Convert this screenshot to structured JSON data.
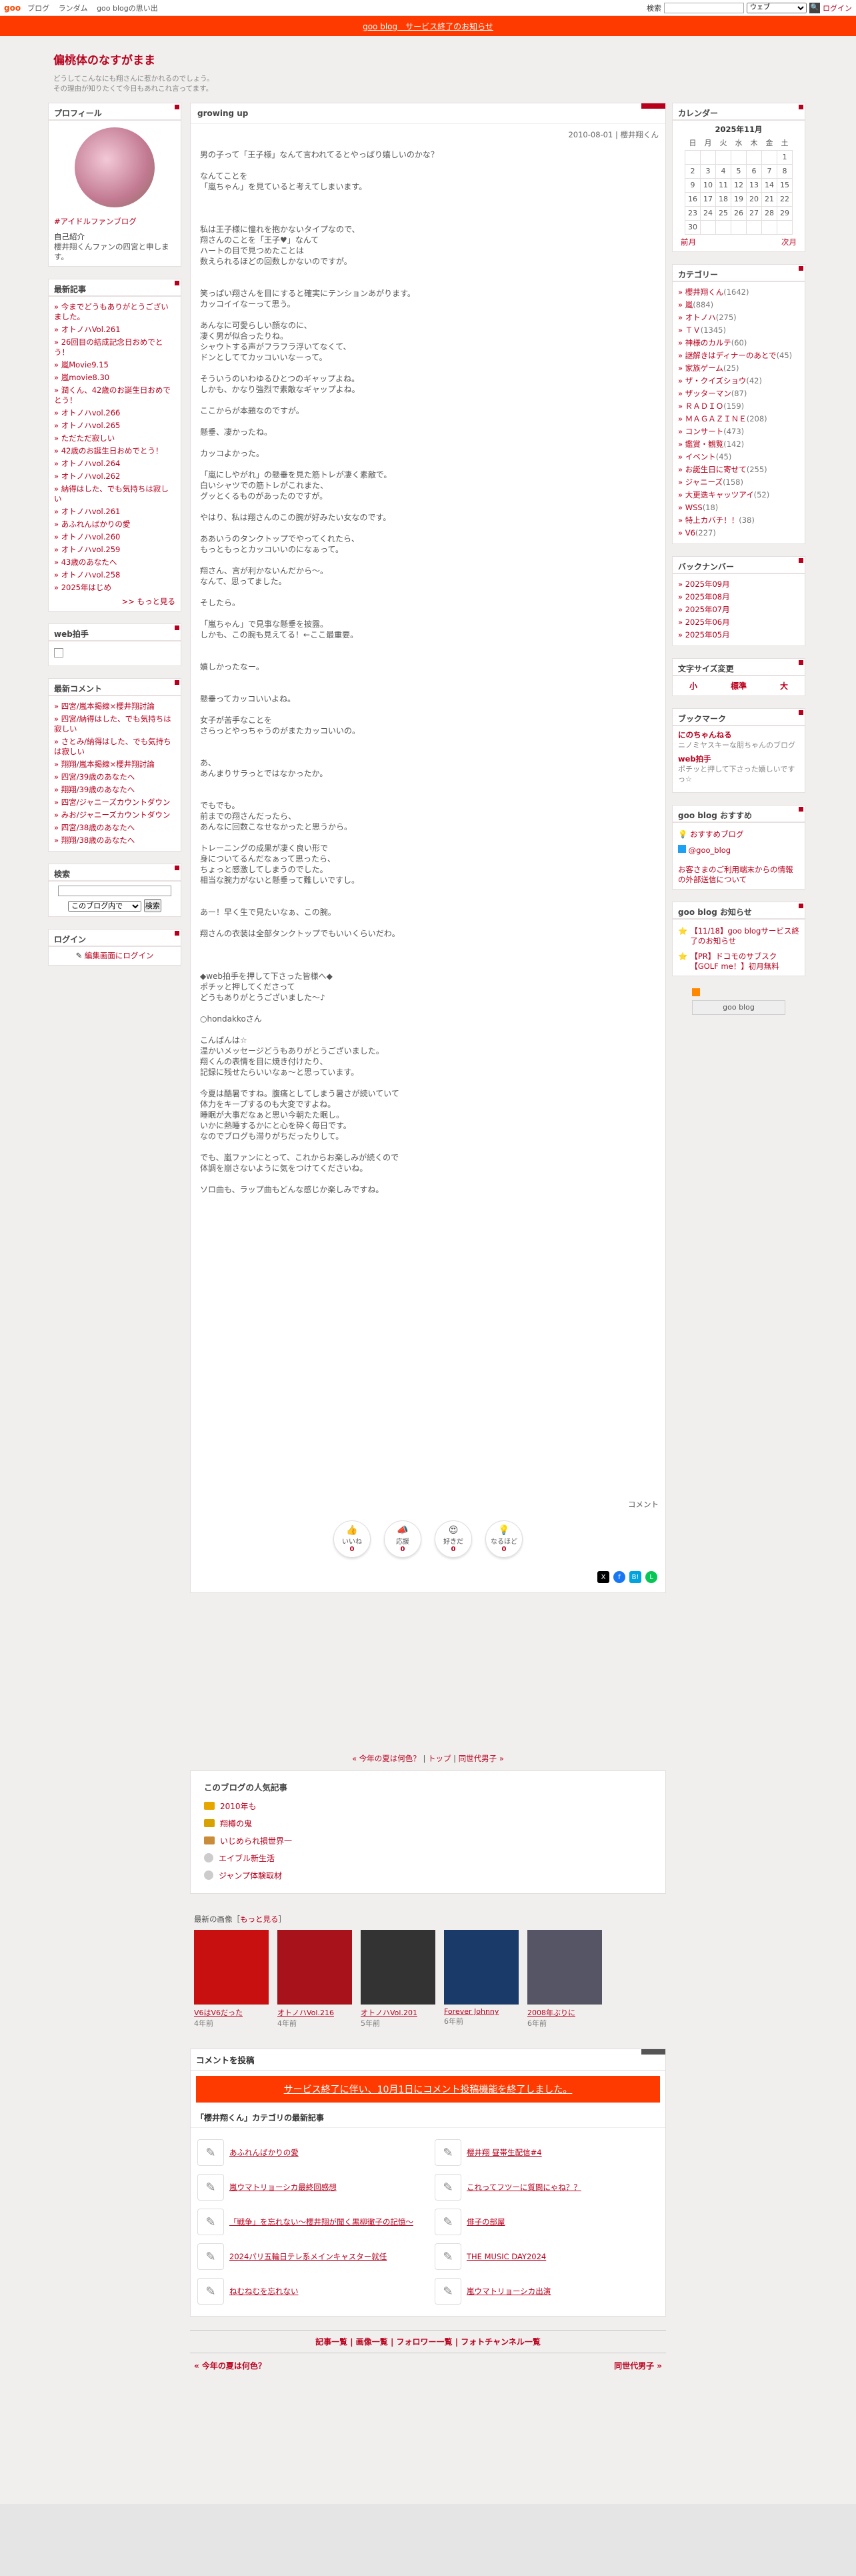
{
  "topbar": {
    "logo": "goo",
    "nav": [
      "ブログ",
      "ランダム",
      "goo blogの思い出"
    ],
    "search_label": "検索",
    "select": "ウェブ",
    "search_btn": "🔍",
    "login": "ログイン"
  },
  "notice": "goo blog　サービス終了のお知らせ",
  "header": {
    "title": "偏桃体のなすがまま",
    "desc1": "どうしてこんなにも翔さんに惹かれるのでしょう。",
    "desc2": "その理由が知りたくて今日もあれこれ言ってます。"
  },
  "profile": {
    "title": "プロフィール",
    "link": "#アイドルファンブログ",
    "intro_head": "自己紹介",
    "intro": "櫻井翔くんファンの四宮と申します。"
  },
  "recent": {
    "title": "最新記事",
    "items": [
      "今までどうもありがとうございました。",
      "オトノハVol.261",
      "26回目の結成記念日おめでとう！",
      "嵐Movie9.15",
      "嵐movie8.30",
      "潤くん、42歳のお誕生日おめでとう！",
      "オトノハvol.266",
      "オトノハvol.265",
      "ただただ寂しい",
      "42歳のお誕生日おめでとう！",
      "オトノハvol.264",
      "オトノハvol.262",
      "納得はした、でも気持ちは寂しい",
      "オトノハvol.261",
      "あふれんばかりの愛",
      "オトノハvol.260",
      "オトノハvol.259",
      "43歳のあなたへ",
      "オトノハvol.258",
      "2025年はじめ"
    ],
    "more": ">> もっと見る"
  },
  "webhand": {
    "title": "web拍手"
  },
  "comments": {
    "title": "最新コメント",
    "items": [
      "四宮/嵐本掲線×櫻井翔討論",
      "四宮/納得はした、でも気持ちは寂しい",
      "さとみ/納得はした、でも気持ちは寂しい",
      "翔翔/嵐本掲線×櫻井翔討論",
      "四宮/39歳のあなたへ",
      "翔翔/39歳のあなたへ",
      "四宮/ジャニーズカウントダウン",
      "みお/ジャニーズカウントダウン",
      "四宮/38歳のあなたへ",
      "翔翔/38歳のあなたへ"
    ]
  },
  "search": {
    "title": "検索",
    "select": "このブログ内で",
    "btn": "検索"
  },
  "login": {
    "title": "ログイン",
    "link": "編集画面にログイン"
  },
  "article": {
    "title": "growing up",
    "meta": "2010-08-01 | 櫻井翔くん",
    "body": "男の子って「王子様」なんて言われてるとやっぱり嬉しいのかな？\n\nなんてことを\n「嵐ちゃん」を見ていると考えてしまいます。\n\n\n\n私は王子様に憧れを抱かないタイプなので、\n翔さんのことを「王子♥」なんて\nハートの目で見つめたことは\n数えられるほどの回数しかないのですが。\n\n\n笑っぱい翔さんを目にすると確実にテンションあがります。\nカッコイイなーって思う。\n\nあんなに可愛らしい顔なのに、\n凄く男が似合ったりね。\nシャウトする声がフラフラ浮いてなくて、\nドンとしててカッコいいなーって。\n\nそういうのいわゆるひとつのギャップよね。\nしかも、かなり強烈で素敵なギャップよね。\n\nここからが本題なのですが。\n\n懸垂、凄かったね。\n\nカッコよかった。\n\n「嵐にしやがれ」の懸垂を見た筋トレが凄く素敵で。\n白いシャツでの筋トレがこれまた、\nグッとくるものがあったのですが。\n\nやはり、私は翔さんのこの腕が好みたい女なのです。\n\nああいうのタンクトップでやってくれたら、\nもっともっとカッコいいのになぁって。\n\n翔さん、言が利かないんだから～。\nなんて、思ってました。\n\nそしたら。\n\n「嵐ちゃん」で見事な懸垂を披露。\nしかも、この腕も見えてる！←ここ最重要。\n\n\n嬉しかったなー。\n\n\n懸垂ってカッコいいよね。\n\n女子が苦手なことを\nさらっとやっちゃうのがまたカッコいいの。\n\n\nあ、\nあんまりサラっとではなかったか。\n\n\nでもでも。\n前までの翔さんだったら、\nあんなに回数こなせなかったと思うから。\n\nトレーニングの成果が凄く良い形で\n身についてるんだなぁって思ったら、\nちょっと感激してしまうのでした。\n相当な腕力がないと懸垂って難しいですし。\n\n\nあー！早く生で見たいなぁ、この腕。\n\n翔さんの衣装は全部タンクトップでもいいくらいだわ。\n\n\n\n◆web拍手を押して下さった皆様へ◆\nポチッと押してくださって\nどうもありがとうございました～♪\n\n○hondakkoさん\n\nこんばんは☆\n温かいメッセージどうもありがとうございました。\n翔くんの表情を目に焼き付けたり、\n記録に残せたらいいなぁ～と思っています。\n\n今夏は酷暑ですね。腹痛としてしまう暑さが続いていて\n体力をキープするのも大変ですよね。\n睡眠が大事だなぁと思い今朝たた眠し。\nいかに熱睡するかにと心を砕く毎日です。\nなのでブログも滞りがちだったりして。\n\nでも、嵐ファンにとって、これからお楽しみが続くので\n体調を崩さないように気をつけてくださいね。\n\nソロ曲も、ラップ曲もどんな感じか楽しみですね。",
    "comment": "コメント",
    "reactions": [
      {
        "t": "いいね",
        "n": "0"
      },
      {
        "t": "応援",
        "n": "0"
      },
      {
        "t": "好きだ",
        "n": "0"
      },
      {
        "t": "なるほど",
        "n": "0"
      }
    ],
    "react_labels": [
      "いいね",
      "応援",
      "好きだ",
      "なるほど"
    ]
  },
  "pager": {
    "prev": "« 今年の夏は何色？",
    "top": "トップ",
    "next": "同世代男子 »"
  },
  "popular": {
    "title": "このブログの人気記事",
    "items": [
      "2010年も",
      "翔樽の鬼",
      "いじめられ損世界一",
      "エイブル新生活",
      "ジャンプ体験取材"
    ]
  },
  "images": {
    "head": "最新の画像",
    "more": "もっと見る",
    "items": [
      {
        "c": "V6はV6だった",
        "y": "4年前"
      },
      {
        "c": "オトノハVol.216",
        "y": "4年前"
      },
      {
        "c": "オトノハVol.201",
        "y": "5年前"
      },
      {
        "c": "Forever Johnny",
        "y": "6年前"
      },
      {
        "c": "2008年ぶりに",
        "y": "6年前"
      }
    ]
  },
  "post": {
    "head": "コメントを投稿",
    "end": "サービス終了に伴い、10月1日にコメント投稿機能を終了しました。",
    "cat_head": "「櫻井翔くん」カテゴリの最新記事",
    "items": [
      "あふれんばかりの愛",
      "櫻井翔 昼帯生配信#4",
      "嵐ウマトリョーシカ最終回感想",
      "これってフツーに質問にゃね？？",
      "「戦争」を忘れない～櫻井翔が聞く黒柳徹子の記憶～",
      "俳子の部屋",
      "2024パリ五輪日テレ系メインキャスター就任",
      "THE MUSIC DAY2024",
      "ねむねむを忘れない",
      "嵐ウマトリョーシカ出演"
    ]
  },
  "foot": {
    "links": "記事一覧 | 画像一覧 | フォロワー一覧 | フォトチャンネル一覧",
    "prev": "« 今年の夏は何色？",
    "next": "同世代男子 »"
  },
  "calendar": {
    "title": "カレンダー",
    "ym": "2025年11月",
    "days": [
      "日",
      "月",
      "火",
      "水",
      "木",
      "金",
      "土"
    ],
    "rows": [
      [
        "",
        "",
        "",
        "",
        "",
        "",
        "1"
      ],
      [
        "2",
        "3",
        "4",
        "5",
        "6",
        "7",
        "8"
      ],
      [
        "9",
        "10",
        "11",
        "12",
        "13",
        "14",
        "15"
      ],
      [
        "16",
        "17",
        "18",
        "19",
        "20",
        "21",
        "22"
      ],
      [
        "23",
        "24",
        "25",
        "26",
        "27",
        "28",
        "29"
      ],
      [
        "30",
        "",
        "",
        "",
        "",
        "",
        ""
      ]
    ],
    "prev": "前月",
    "next": "次月"
  },
  "category": {
    "title": "カテゴリー",
    "items": [
      {
        "n": "櫻井翔くん",
        "c": "(1642)"
      },
      {
        "n": "嵐",
        "c": "(884)"
      },
      {
        "n": "オトノハ",
        "c": "(275)"
      },
      {
        "n": "ＴＶ",
        "c": "(1345)"
      },
      {
        "n": "神様のカルテ",
        "c": "(60)"
      },
      {
        "n": "謎解きはディナーのあとで",
        "c": "(45)"
      },
      {
        "n": "家族ゲーム",
        "c": "(25)"
      },
      {
        "n": "ザ・クイズショウ",
        "c": "(42)"
      },
      {
        "n": "ザッターマン",
        "c": "(87)"
      },
      {
        "n": "ＲＡＤＩＯ",
        "c": "(159)"
      },
      {
        "n": "ＭＡＧＡＺＩＮＥ",
        "c": "(208)"
      },
      {
        "n": "コンサート",
        "c": "(473)"
      },
      {
        "n": "鑑賞・観覧",
        "c": "(142)"
      },
      {
        "n": "イベント",
        "c": "(45)"
      },
      {
        "n": "お誕生日に寄せて",
        "c": "(255)"
      },
      {
        "n": "ジャニーズ",
        "c": "(158)"
      },
      {
        "n": "大更迭キャッツアイ",
        "c": "(52)"
      },
      {
        "n": "WSS",
        "c": "(18)"
      },
      {
        "n": "特上カバチ！！",
        "c": "(38)"
      },
      {
        "n": "V6",
        "c": "(227)"
      }
    ]
  },
  "backnum": {
    "title": "バックナンバー",
    "items": [
      "2025年09月",
      "2025年08月",
      "2025年07月",
      "2025年06月",
      "2025年05月"
    ]
  },
  "fontsize": {
    "title": "文字サイズ変更",
    "s": "小",
    "m": "標準",
    "l": "大"
  },
  "bookmark": {
    "title": "ブックマーク",
    "items": [
      {
        "t": "にのちゃんねる",
        "d": "ニノミヤスキーな朋ちゃんのブログ"
      },
      {
        "t": "web拍手",
        "d": "ポチッと押して下さった嬉しいですっ☆"
      }
    ]
  },
  "goorec": {
    "title": "goo blog おすすめ",
    "items": [
      "おすすめブログ",
      "@goo_blog",
      "お客さまのご利用端末からの情報の外部送信について"
    ]
  },
  "goonews": {
    "title": "goo blog お知らせ",
    "items": [
      "【11/18】goo blogサービス終了のお知らせ",
      "【PR】ドコモのサブスク【GOLF me！】初月無料"
    ]
  },
  "gooblog_btn": "goo blog"
}
